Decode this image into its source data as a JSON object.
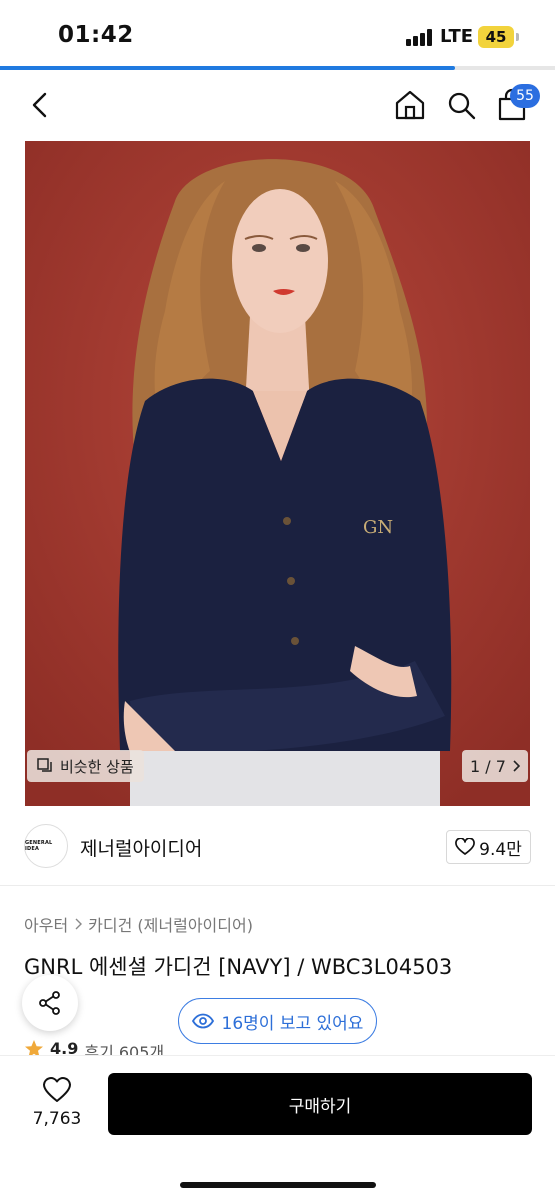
{
  "status_bar": {
    "time": "01:42",
    "network": "LTE",
    "battery": "45",
    "load_progress": 0.82
  },
  "nav": {
    "back_icon": "chevron-left-icon",
    "home_icon": "home-icon",
    "search_icon": "search-icon",
    "cart_icon": "shopping-bag-icon",
    "cart_count": "55"
  },
  "gallery": {
    "similar_label": "비슷한 상품",
    "page_indicator": "1 / 7",
    "image_description_icon": "product-photo"
  },
  "brand": {
    "logo_text": "GENERAL IDEA",
    "name": "제너럴아이디어",
    "like_count": "9.4만"
  },
  "breadcrumb": {
    "category": "아우터",
    "subcategory": "카디건 (제너럴아이디어)"
  },
  "product": {
    "title": "GNRL 에센셜 가디건 [NAVY] / WBC3L04503",
    "viewers_text": "16명이 보고 있어요",
    "rating": "4.9",
    "reviews": "후기 605개"
  },
  "bottom_bar": {
    "wish_count": "7,763",
    "buy_label": "구매하기"
  },
  "colors": {
    "accent_blue": "#2d6fd8",
    "buy_button": "#000000",
    "hero_background": "#a63a2f",
    "star": "#f0a93a"
  }
}
